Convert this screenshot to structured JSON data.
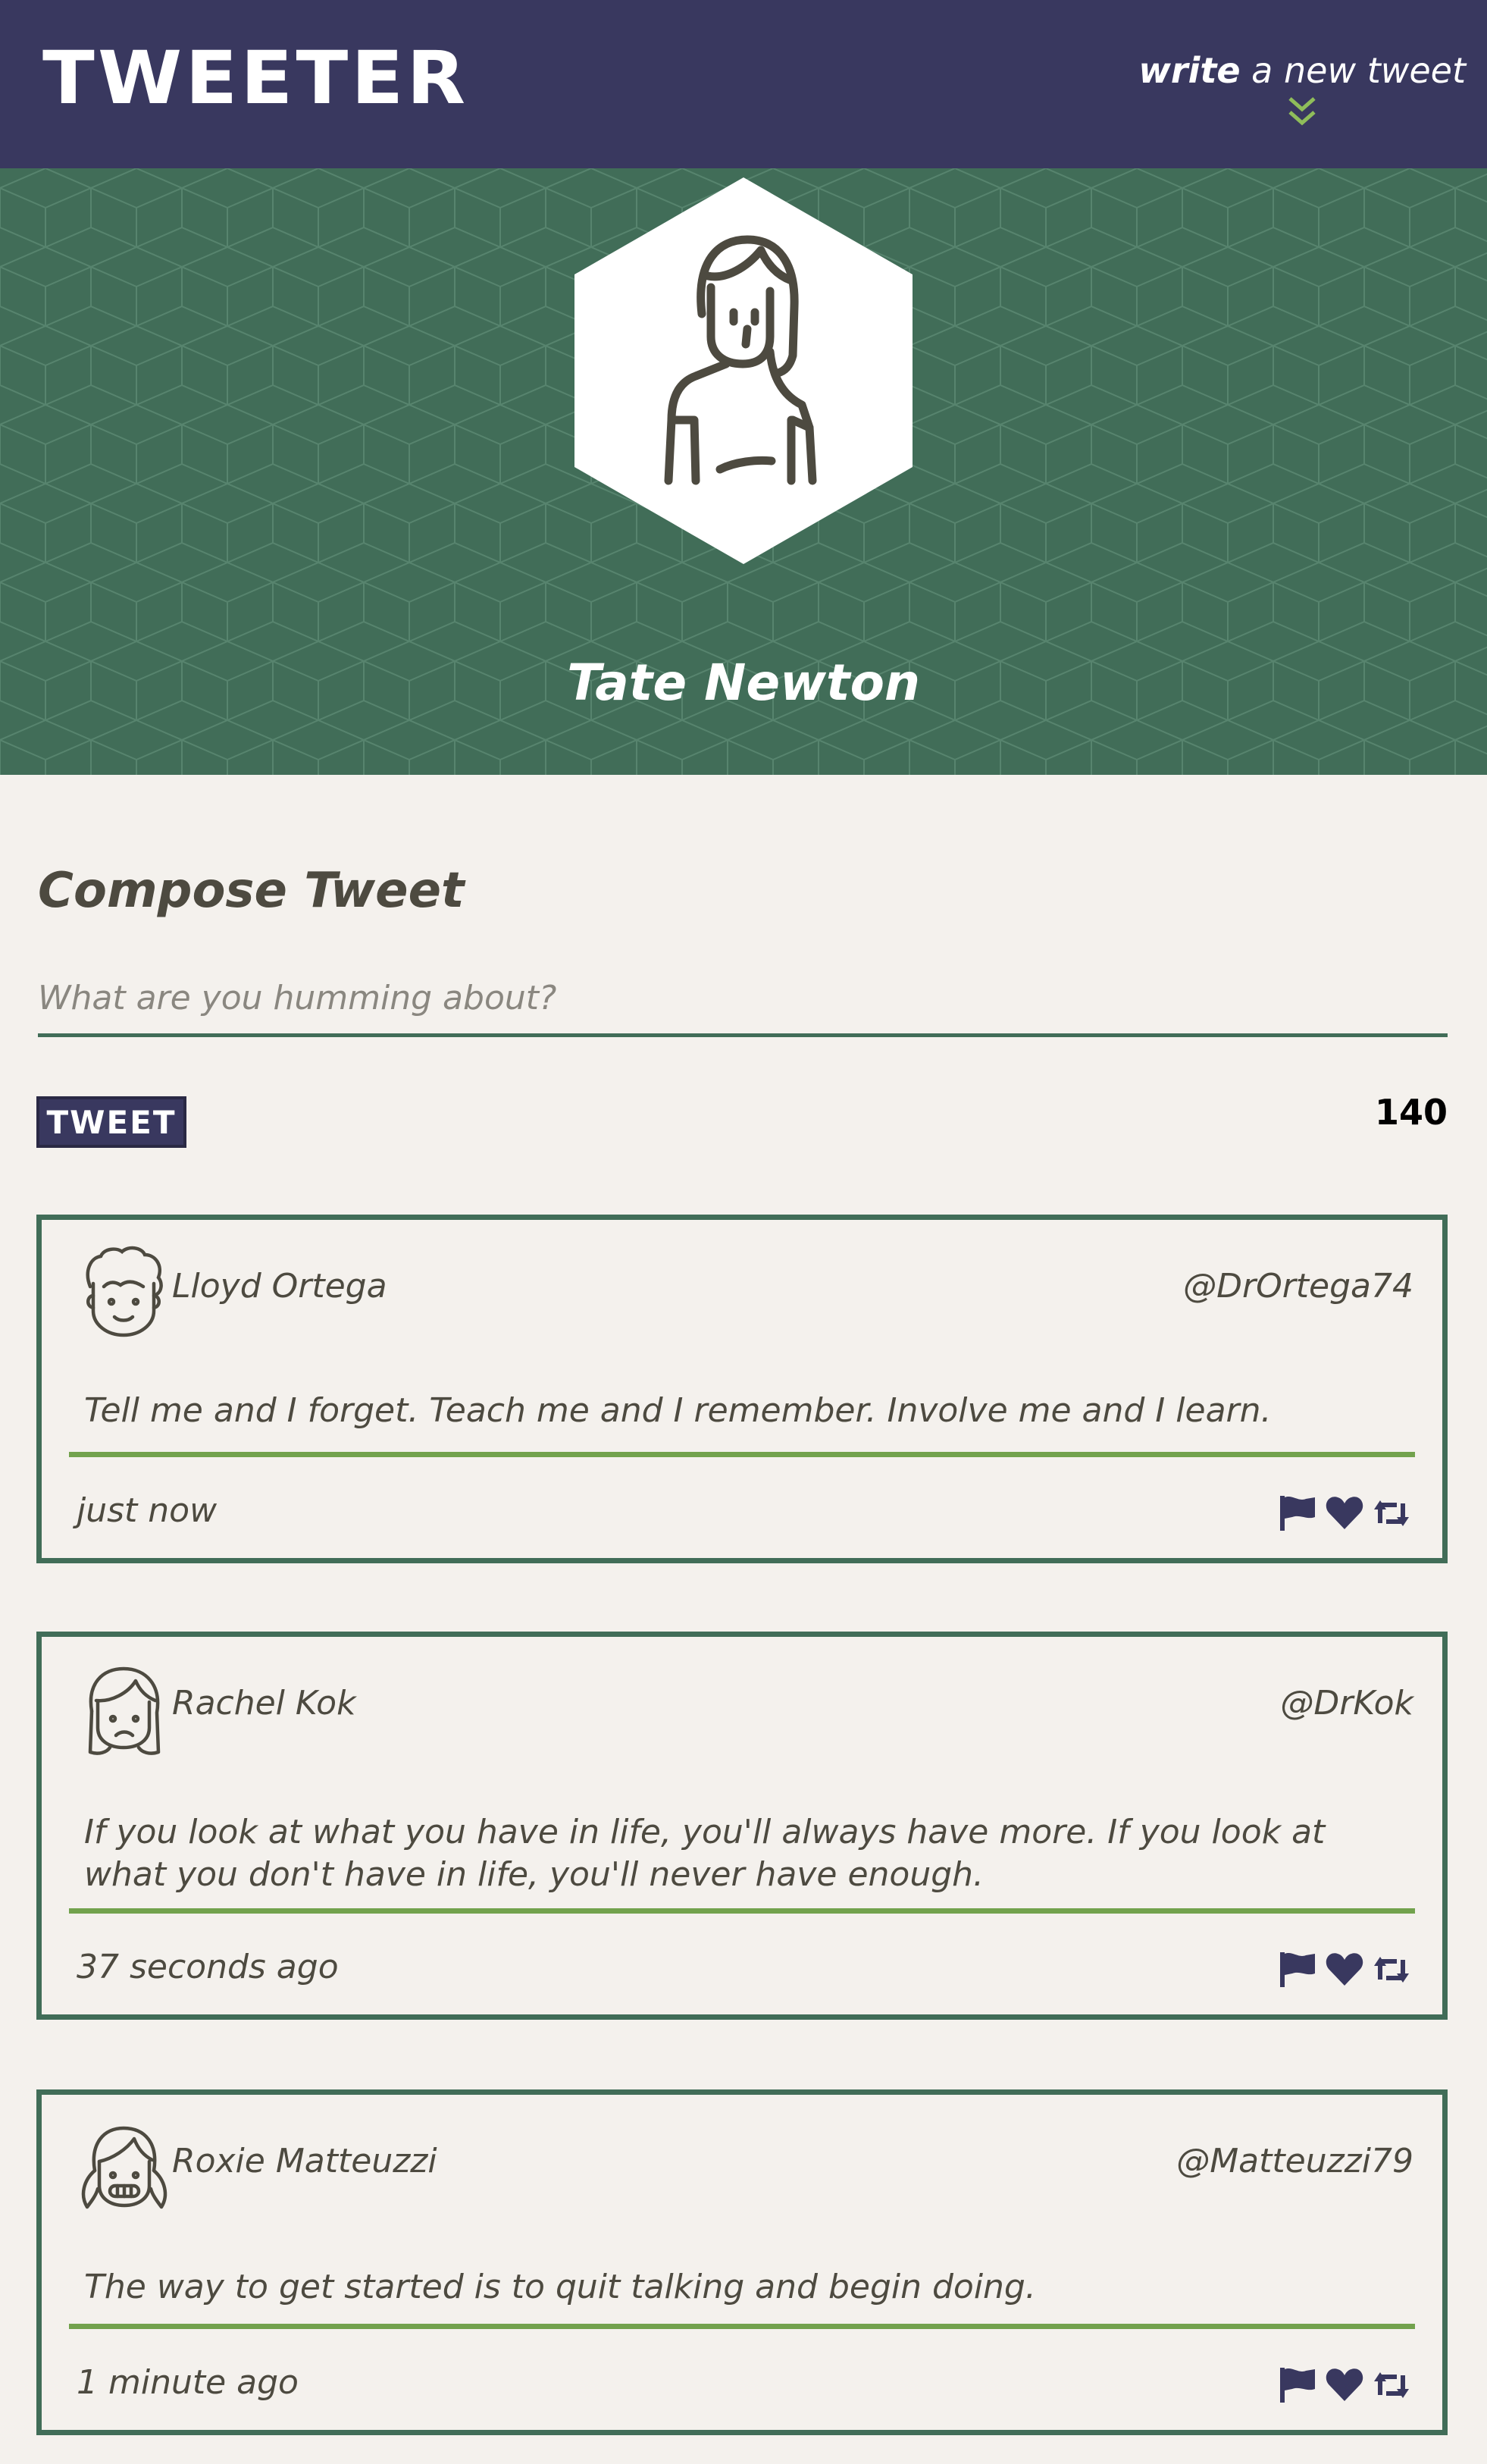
{
  "nav": {
    "logo": "TWEETER",
    "cta_strong": "write",
    "cta_rest": " a new tweet"
  },
  "profile": {
    "name": "Tate Newton"
  },
  "compose": {
    "title": "Compose Tweet",
    "placeholder": "What are you humming about?",
    "button_label": "TWEET",
    "counter": "140"
  },
  "tweets": [
    {
      "name": "Lloyd Ortega",
      "handle": "@DrOrtega74",
      "text": "Tell me and I forget. Teach me and I remember. Involve me and I learn.",
      "time": "just now"
    },
    {
      "name": "Rachel Kok",
      "handle": "@DrKok",
      "text": "If you look at what you have in life, you'll always have more. If you look at what you don't have in life, you'll never have enough.",
      "time": "37 seconds ago"
    },
    {
      "name": "Roxie Matteuzzi",
      "handle": "@Matteuzzi79",
      "text": "The way to get started is to quit talking and begin doing.",
      "time": "1 minute ago"
    }
  ],
  "colors": {
    "nav_bg": "#39385f",
    "profile_bg": "#416d58",
    "accent_green": "#72a24d",
    "page_bg": "#f4f1ed",
    "text": "#4d4a40"
  },
  "icons": [
    "double-chevron-down-icon",
    "user-avatar-icon",
    "flag-icon",
    "heart-icon",
    "retweet-icon"
  ]
}
